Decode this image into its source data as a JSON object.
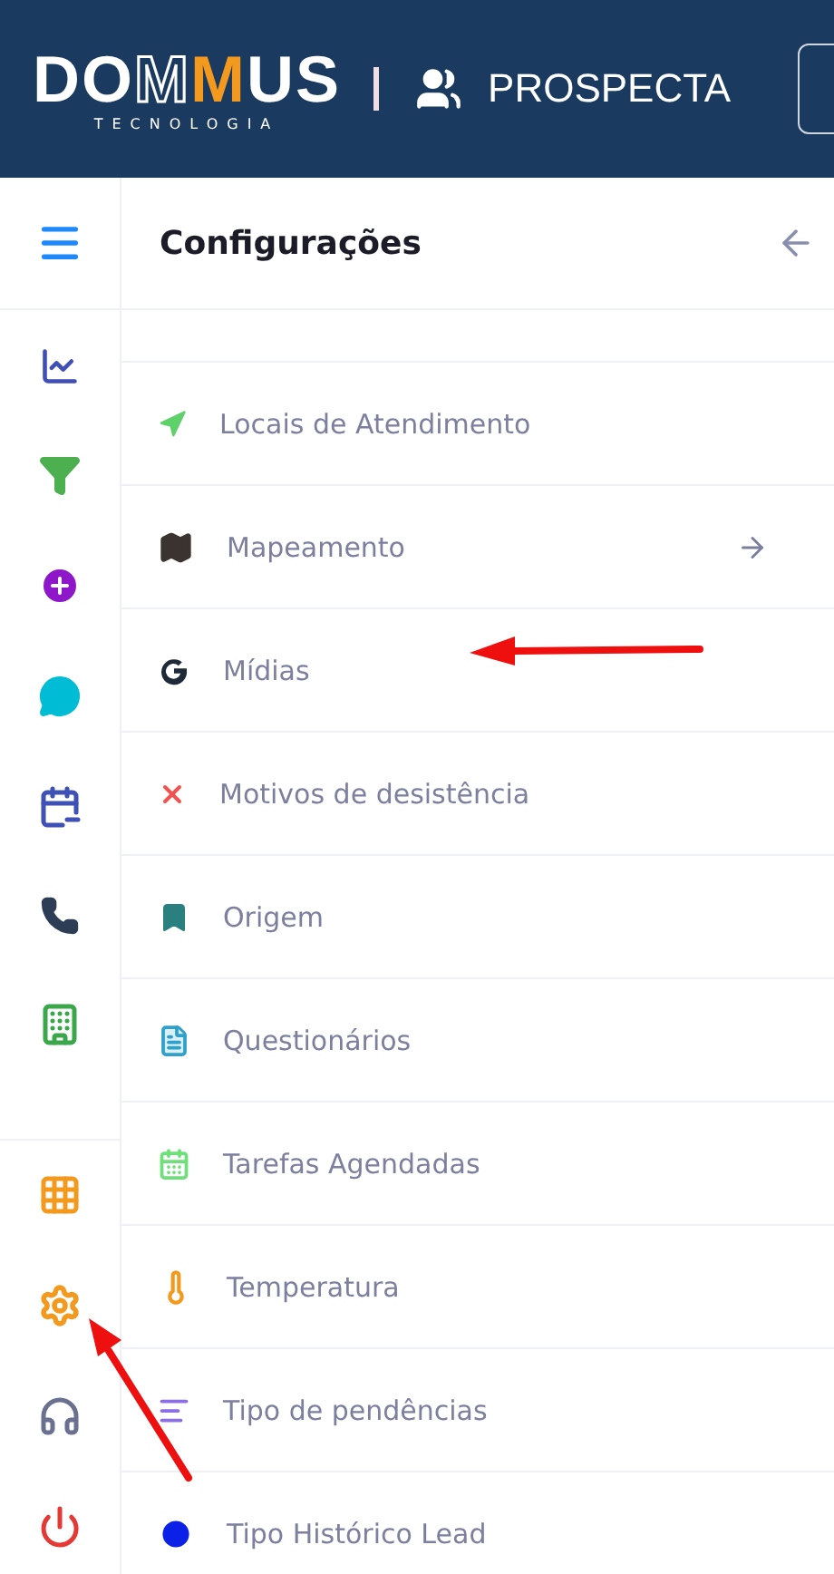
{
  "header": {
    "logo": {
      "start": "DO",
      "outline": "M",
      "accent": "M",
      "end": "US"
    },
    "logo_subtitle": "TECNOLOGIA",
    "module": "PROSPECTA"
  },
  "panel": {
    "title": "Configurações"
  },
  "settings_items": [
    {
      "label": "Locais de Atendimento",
      "submenu": false
    },
    {
      "label": "Mapeamento",
      "submenu": true
    },
    {
      "label": "Mídias",
      "submenu": false
    },
    {
      "label": "Motivos de desistência",
      "submenu": false
    },
    {
      "label": "Origem",
      "submenu": false
    },
    {
      "label": "Questionários",
      "submenu": false
    },
    {
      "label": "Tarefas Agendadas",
      "submenu": false
    },
    {
      "label": "Temperatura",
      "submenu": false
    },
    {
      "label": "Tipo de pendências",
      "submenu": false
    },
    {
      "label": "Tipo Histórico Lead",
      "submenu": false
    }
  ]
}
